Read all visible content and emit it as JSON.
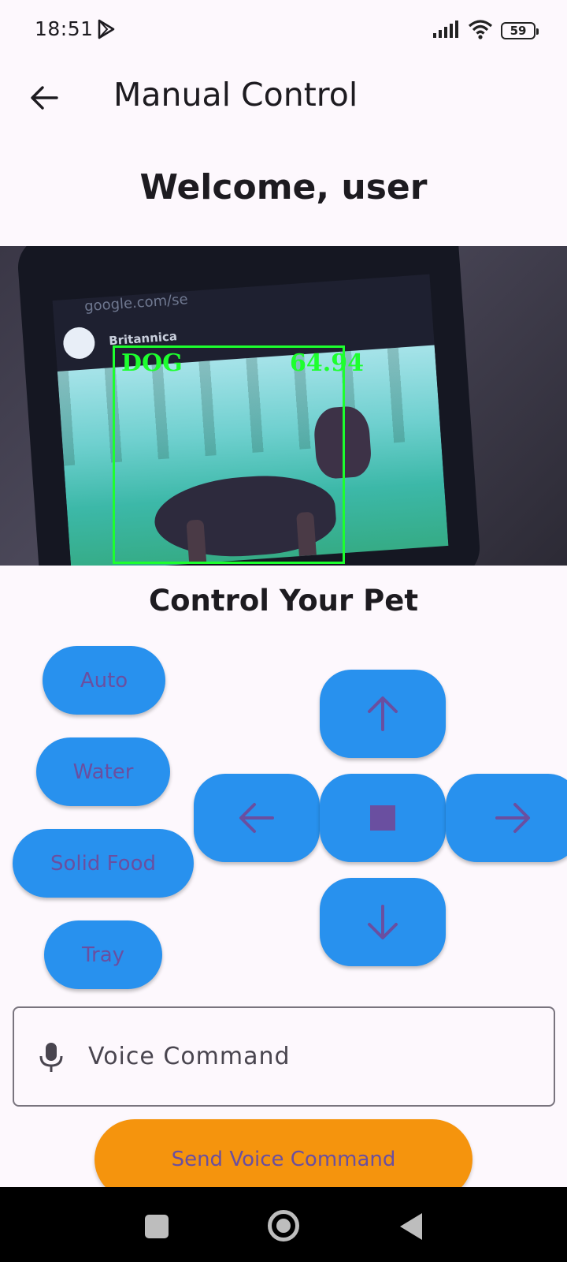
{
  "status_bar": {
    "time": "18:51",
    "battery": "59",
    "icons": [
      "play-icon",
      "signal-icon",
      "wifi-icon",
      "battery-icon"
    ]
  },
  "app_bar": {
    "title": "Manual Control",
    "back_icon": "arrow-back-icon"
  },
  "welcome": "Welcome, user",
  "camera": {
    "url_text": "google.com/se",
    "site_name": "Britannica",
    "detection_label": "DOG",
    "detection_score": "64.94",
    "detection_color": "#1dff2e"
  },
  "control": {
    "title": "Control Your Pet",
    "modes": [
      "Auto",
      "Water",
      "Solid Food",
      "Tray"
    ],
    "dpad_icons": {
      "up": "arrow-up-icon",
      "left": "arrow-left-icon",
      "stop": "stop-icon",
      "right": "arrow-right-icon",
      "down": "arrow-down-icon"
    }
  },
  "voice": {
    "placeholder": "Voice Command",
    "send_label": "Send Voice Command"
  },
  "colors": {
    "button_blue": "#2891ee",
    "button_text": "#6a4fa0",
    "send_orange": "#f5940d",
    "background": "#fdf8fd"
  }
}
